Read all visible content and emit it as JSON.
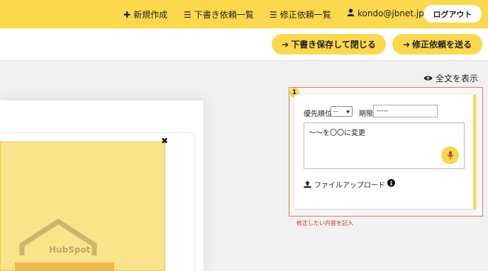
{
  "nav": {
    "new_label": "新規作成",
    "drafts_label": "下書き依頼一覧",
    "revisions_label": "修正依頼一覧",
    "user_label": "kondo@jbnet.jp",
    "logout_label": "ログアウト"
  },
  "toolbar": {
    "save_close_label": "下書き保存して閉じる",
    "send_label": "修正依頼を送る"
  },
  "view": {
    "show_all_label": "全文を表示"
  },
  "comment": {
    "number": "1",
    "priority_label": "優先順位",
    "priority_value": "--",
    "deadline_label": "期限",
    "deadline_value": "-----",
    "body_text": "〜〜を〇〇に変更",
    "upload_label": "ファイルアップロード",
    "hint_text": "修正したい内容を記入"
  },
  "colors": {
    "accent_yellow": "#fcd84d",
    "panel_border": "#e07a5a",
    "hint_red": "#c0392b"
  },
  "icons": {
    "new": "plus-icon",
    "drafts": "list-icon",
    "revisions": "list-icon",
    "user": "user-icon",
    "arrow": "arrow-right-icon",
    "eye": "eye-icon",
    "mic": "microphone-icon",
    "upload": "upload-icon",
    "info": "info-icon",
    "close": "close-icon"
  }
}
